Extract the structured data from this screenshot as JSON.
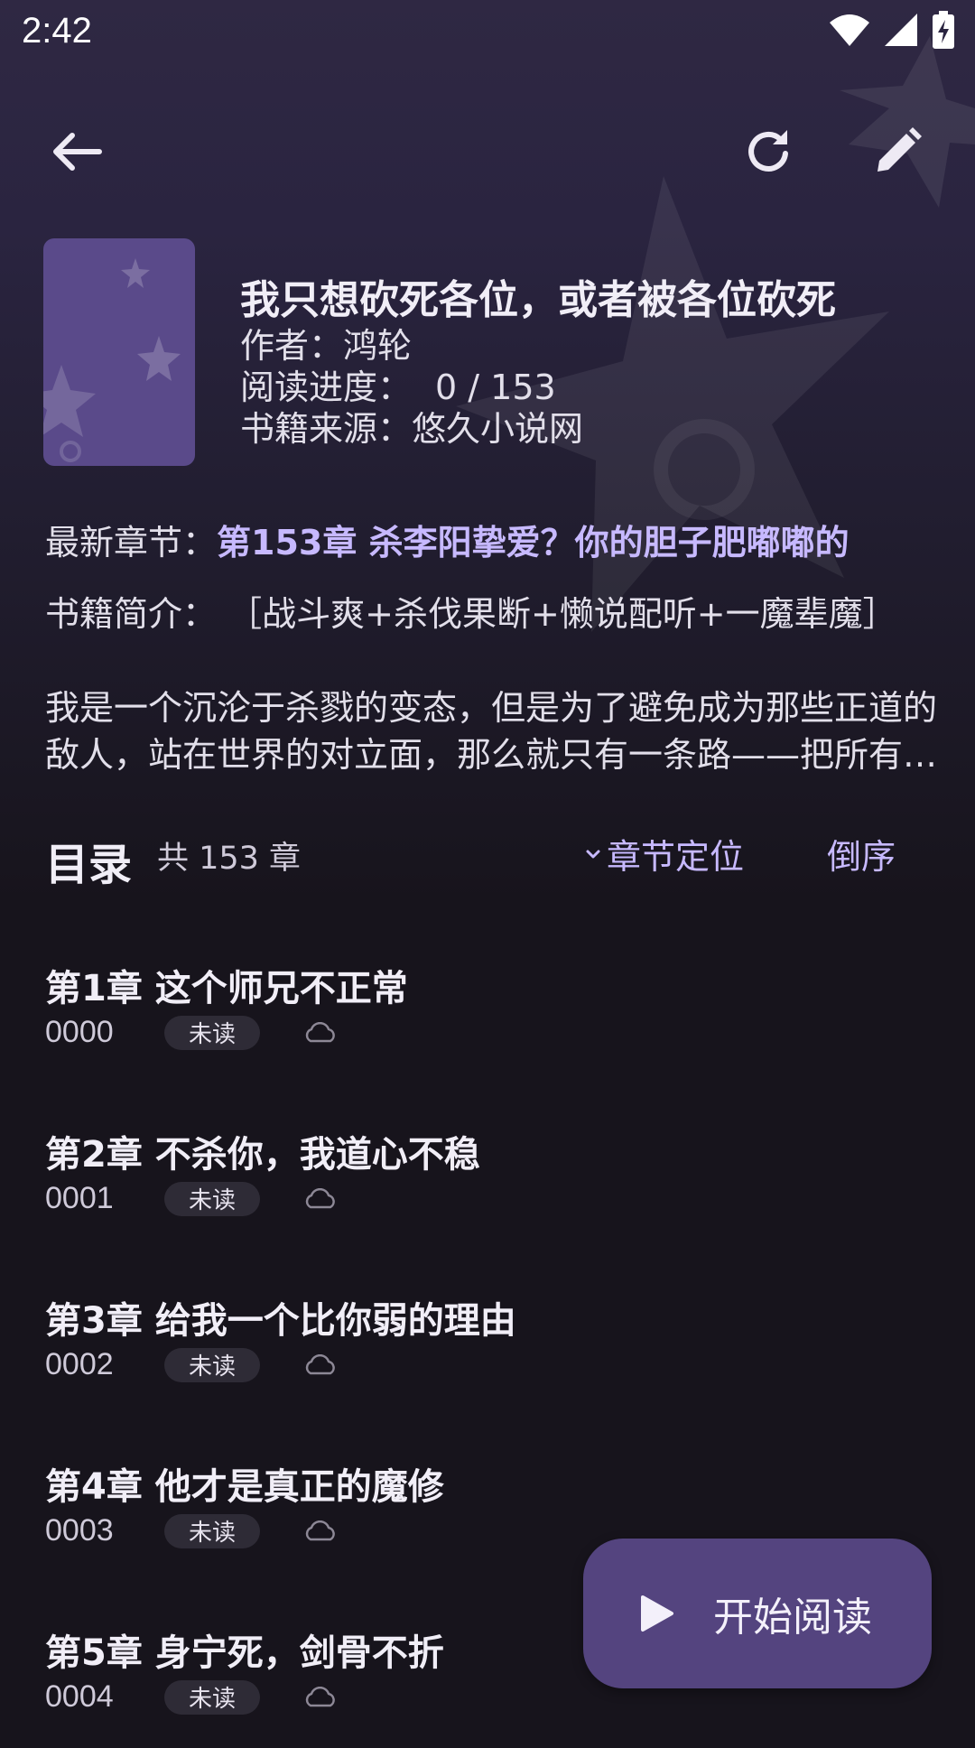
{
  "status_bar": {
    "time": "2:42"
  },
  "toolbar": {
    "back_icon": "arrow-left-icon",
    "refresh_icon": "refresh-icon",
    "edit_icon": "pencil-icon"
  },
  "book": {
    "title": "我只想砍死各位，或者被各位砍死",
    "author_label": "作者：",
    "author": "鸿轮",
    "progress_label": "阅读进度：",
    "progress": "0 / 153",
    "source_label": "书籍来源：",
    "source": "悠久小说网",
    "latest_label": "最新章节：",
    "latest_chapter": "第153章 杀李阳挚爱？你的胆子肥嘟嘟的",
    "intro_label": "书籍简介：",
    "intro_tags": "［战斗爽+杀伐果断+懒说配听+一魔辈魔］",
    "intro_body": "我是一个沉沦于杀戮的变态，但是为了避免成为那些正道的敌人，站在世界的对立面，那么就只有一条路——把所有敌人都杀光"
  },
  "toc": {
    "title": "目录",
    "count": "共 153 章",
    "locate_label": "章节定位",
    "reverse_label": "倒序"
  },
  "chapters": [
    {
      "title": "第1章 这个师兄不正常",
      "num": "0000",
      "status": "未读"
    },
    {
      "title": "第2章 不杀你，我道心不稳",
      "num": "0001",
      "status": "未读"
    },
    {
      "title": "第3章 给我一个比你弱的理由",
      "num": "0002",
      "status": "未读"
    },
    {
      "title": "第4章 他才是真正的魔修",
      "num": "0003",
      "status": "未读"
    },
    {
      "title": "第5章 身宁死，剑骨不折",
      "num": "0004",
      "status": "未读"
    }
  ],
  "fab": {
    "label": "开始阅读",
    "icon": "play-icon"
  },
  "colors": {
    "accent": "#c7b9ff",
    "fab_bg": "#54447f",
    "cover_bg": "#5a4a8a",
    "background": "#17141c"
  }
}
